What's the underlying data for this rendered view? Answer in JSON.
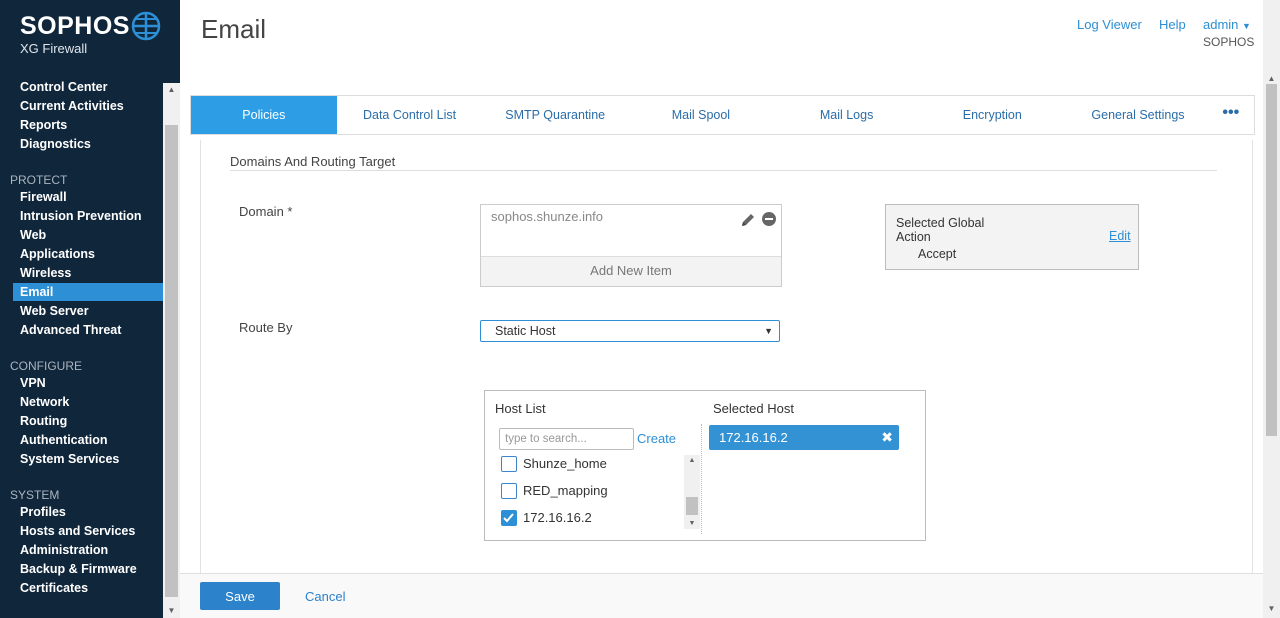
{
  "brand": {
    "name": "SOPHOS",
    "product": "XG Firewall"
  },
  "sidebar": {
    "top_items": [
      "Control Center",
      "Current Activities",
      "Reports",
      "Diagnostics"
    ],
    "protect": {
      "heading": "PROTECT",
      "items": [
        "Firewall",
        "Intrusion Prevention",
        "Web",
        "Applications",
        "Wireless",
        "Email",
        "Web Server",
        "Advanced Threat"
      ]
    },
    "configure": {
      "heading": "CONFIGURE",
      "items": [
        "VPN",
        "Network",
        "Routing",
        "Authentication",
        "System Services"
      ]
    },
    "system": {
      "heading": "SYSTEM",
      "items": [
        "Profiles",
        "Hosts and Services",
        "Administration",
        "Backup & Firmware",
        "Certificates"
      ]
    },
    "active": "Email"
  },
  "header": {
    "title": "Email",
    "log_viewer": "Log Viewer",
    "help": "Help",
    "user": "admin",
    "org": "SOPHOS"
  },
  "tabs": [
    "Policies",
    "Data Control List",
    "SMTP Quarantine",
    "Mail Spool",
    "Mail Logs",
    "Encryption",
    "General Settings"
  ],
  "active_tab": "Policies",
  "form": {
    "section_title": "Domains And Routing Target",
    "domain_label": "Domain *",
    "domain_value": "sophos.shunze.info",
    "add_new_item": "Add New Item",
    "global_action_label": "Selected Global Action",
    "global_action_value": "Accept",
    "global_edit": "Edit",
    "route_by_label": "Route By",
    "route_by_value": "Static Host",
    "host_list_heading": "Host List",
    "search_placeholder": "type to search...",
    "create": "Create",
    "hosts": [
      {
        "name": "Shunze_home",
        "checked": false
      },
      {
        "name": "RED_mapping",
        "checked": false
      },
      {
        "name": "172.16.16.2",
        "checked": true
      }
    ],
    "selected_host_heading": "Selected Host",
    "selected_hosts": [
      "172.16.16.2"
    ]
  },
  "footer": {
    "save": "Save",
    "cancel": "Cancel"
  },
  "colors": {
    "sidebar_bg": "#10263b",
    "accent": "#2d8fd5",
    "active_tab": "#2d9de5"
  }
}
